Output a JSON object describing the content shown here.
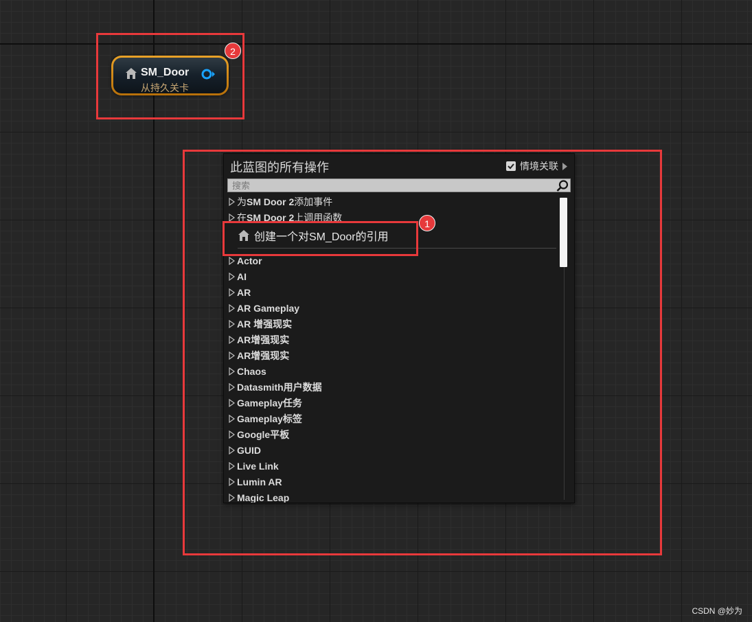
{
  "node": {
    "title": "SM_Door",
    "subtitle": "从持久关卡"
  },
  "menu": {
    "title": "此蓝图的所有操作",
    "context_label": "情境关联",
    "context_checked": true,
    "search_placeholder": "搜索",
    "event_items": [
      {
        "prefix": "为 ",
        "name": "SM Door 2",
        "suffix": "添加事件"
      },
      {
        "prefix": "在 ",
        "name": "SM Door 2",
        "suffix": "上调用函数"
      }
    ],
    "reference_item": "创建一个对SM_Door的引用",
    "categories": [
      "Actor",
      "AI",
      "AR",
      "AR Gameplay",
      "AR 增强现实",
      "AR增强现实",
      "AR增强现实",
      "Chaos",
      "Datasmith用户数据",
      "Gameplay任务",
      "Gameplay标签",
      "Google平板",
      "GUID",
      "Live Link",
      "Lumin AR",
      "Magic Leap"
    ]
  },
  "annotations": {
    "badge_1": "1",
    "badge_2": "2"
  },
  "watermark": "CSDN @妙为"
}
